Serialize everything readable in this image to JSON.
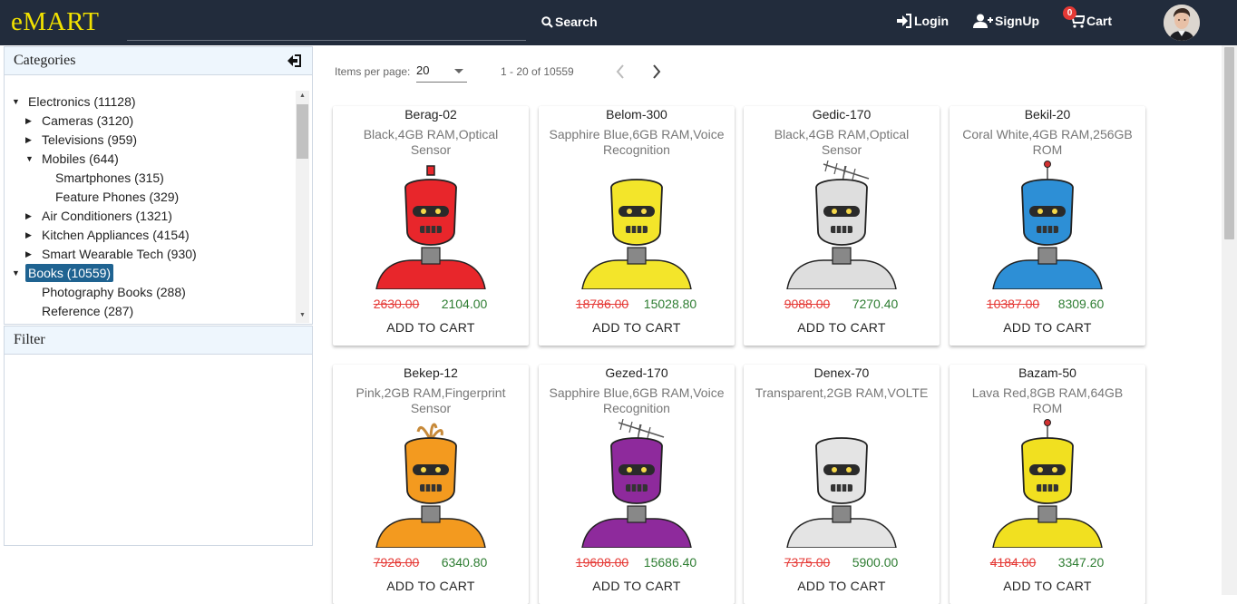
{
  "header": {
    "logo": "eMART",
    "search_label": "Search",
    "login_label": "Login",
    "signup_label": "SignUp",
    "cart_label": "Cart",
    "cart_count": "0"
  },
  "sidebar": {
    "categories_title": "Categories",
    "filter_title": "Filter",
    "tree": [
      {
        "label": "Electronics (11128)",
        "level": 0,
        "caret": "down"
      },
      {
        "label": "Cameras (3120)",
        "level": 1,
        "caret": "right"
      },
      {
        "label": "Televisions (959)",
        "level": 1,
        "caret": "right"
      },
      {
        "label": "Mobiles (644)",
        "level": 1,
        "caret": "down"
      },
      {
        "label": "Smartphones (315)",
        "level": 2,
        "caret": ""
      },
      {
        "label": "Feature Phones (329)",
        "level": 2,
        "caret": ""
      },
      {
        "label": "Air Conditioners (1321)",
        "level": 1,
        "caret": "right"
      },
      {
        "label": "Kitchen Appliances (4154)",
        "level": 1,
        "caret": "right"
      },
      {
        "label": "Smart Wearable Tech (930)",
        "level": 1,
        "caret": "right"
      },
      {
        "label": "Books (10559)",
        "level": 0,
        "caret": "down",
        "selected": true
      },
      {
        "label": "Photography Books (288)",
        "level": 1,
        "caret": ""
      },
      {
        "label": "Reference (287)",
        "level": 1,
        "caret": ""
      }
    ]
  },
  "pager": {
    "items_per_page_label": "Items per page:",
    "items_per_page_value": "20",
    "range": "1 - 20 of 10559"
  },
  "products": [
    {
      "name": "Berag-02",
      "desc": "Black,4GB RAM,Optical Sensor",
      "old_price": "2630.00",
      "new_price": "2104.00",
      "color": "#e8262b",
      "antenna": "ball"
    },
    {
      "name": "Belom-300",
      "desc": "Sapphire Blue,6GB RAM,Voice Recognition",
      "old_price": "18786.00",
      "new_price": "15028.80",
      "color": "#f3e52a",
      "antenna": "none"
    },
    {
      "name": "Gedic-170",
      "desc": "Black,4GB RAM,Optical Sensor",
      "old_price": "9088.00",
      "new_price": "7270.40",
      "color": "#dedede",
      "antenna": "tv"
    },
    {
      "name": "Bekil-20",
      "desc": "Coral White,4GB RAM,256GB ROM",
      "old_price": "10387.00",
      "new_price": "8309.60",
      "color": "#2d8fd6",
      "antenna": "stick"
    },
    {
      "name": "Bekep-12",
      "desc": "Pink,2GB RAM,Fingerprint Sensor",
      "old_price": "7926.00",
      "new_price": "6340.80",
      "color": "#f39a1f",
      "antenna": "tuft"
    },
    {
      "name": "Gezed-170",
      "desc": "Sapphire Blue,6GB RAM,Voice Recognition",
      "old_price": "19608.00",
      "new_price": "15686.40",
      "color": "#8e2a9c",
      "antenna": "tv"
    },
    {
      "name": "Denex-70",
      "desc": "Transparent,2GB RAM,VOLTE",
      "old_price": "7375.00",
      "new_price": "5900.00",
      "color": "#e4e4e4",
      "antenna": "none"
    },
    {
      "name": "Bazam-50",
      "desc": "Lava Red,8GB RAM,64GB ROM",
      "old_price": "4184.00",
      "new_price": "3347.20",
      "color": "#f1e020",
      "antenna": "stick"
    }
  ],
  "add_to_cart_label": "ADD TO CART"
}
